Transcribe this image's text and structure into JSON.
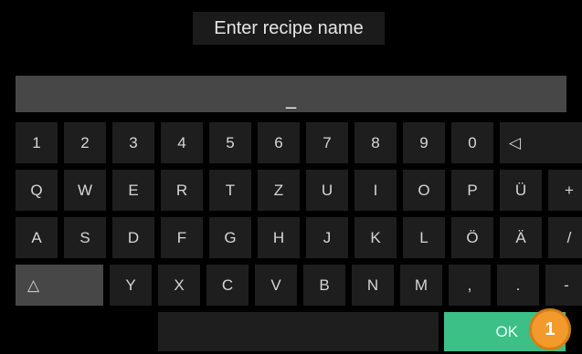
{
  "header": {
    "title": "Enter recipe name"
  },
  "input": {
    "value": "_"
  },
  "keyboard": {
    "row1": [
      "1",
      "2",
      "3",
      "4",
      "5",
      "6",
      "7",
      "8",
      "9",
      "0"
    ],
    "backspace": "◁",
    "row2": [
      "Q",
      "W",
      "E",
      "R",
      "T",
      "Z",
      "U",
      "I",
      "O",
      "P",
      "Ü",
      "+"
    ],
    "row3": [
      "A",
      "S",
      "D",
      "F",
      "G",
      "H",
      "J",
      "K",
      "L",
      "Ö",
      "Ä",
      "/"
    ],
    "shift": "△",
    "row4": [
      "Y",
      "X",
      "C",
      "V",
      "B",
      "N",
      "M",
      ",",
      ".",
      "-"
    ]
  },
  "footer": {
    "space_label": "",
    "ok_label": "OK"
  },
  "annotation": {
    "badge": "1",
    "color": "#f29b2c"
  },
  "colors": {
    "background": "#000000",
    "key": "#1e1e1e",
    "input": "#474747",
    "ok": "#3dbf88"
  }
}
